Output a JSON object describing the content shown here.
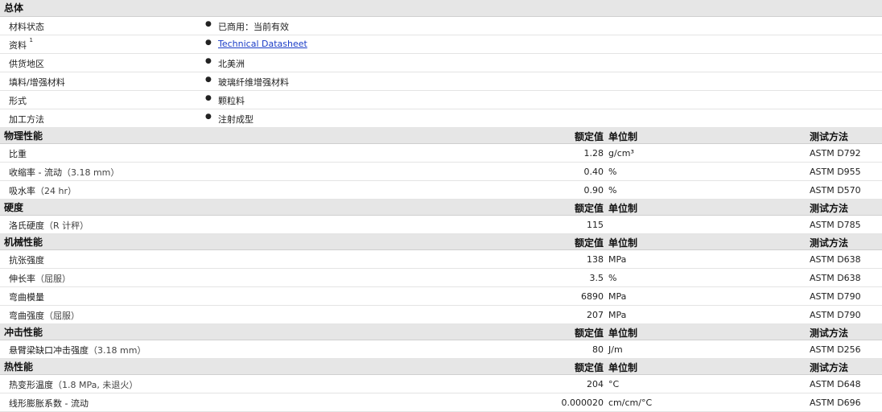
{
  "general": {
    "title": "总体",
    "rows": [
      {
        "label": "材料状态",
        "sup": "",
        "value": "已商用：当前有效",
        "link": false
      },
      {
        "label": "资料",
        "sup": "1",
        "value": "Technical Datasheet",
        "link": true
      },
      {
        "label": "供货地区",
        "sup": "",
        "value": "北美洲",
        "link": false
      },
      {
        "label": "填料/增强材料",
        "sup": "",
        "value": "玻璃纤维增强材料",
        "link": false
      },
      {
        "label": "形式",
        "sup": "",
        "value": "颗粒料",
        "link": false
      },
      {
        "label": "加工方法",
        "sup": "",
        "value": "注射成型",
        "link": false
      }
    ]
  },
  "headers": {
    "value": "额定值",
    "unit": "单位制",
    "method": "测试方法"
  },
  "sections": [
    {
      "title": "物理性能",
      "rows": [
        {
          "label": "比重",
          "cond": "",
          "value": "1.28",
          "unit": "g/cm³",
          "method": "ASTM D792"
        },
        {
          "label": "收缩率 - 流动",
          "cond": "（3.18 mm）",
          "value": "0.40",
          "unit": "%",
          "method": "ASTM D955"
        },
        {
          "label": "吸水率",
          "cond": "（24 hr）",
          "value": "0.90",
          "unit": "%",
          "method": "ASTM D570"
        }
      ]
    },
    {
      "title": "硬度",
      "rows": [
        {
          "label": "洛氏硬度",
          "cond": "（R 计秤）",
          "value": "115",
          "unit": "",
          "method": "ASTM D785"
        }
      ]
    },
    {
      "title": "机械性能",
      "rows": [
        {
          "label": "抗张强度",
          "cond": "",
          "value": "138",
          "unit": "MPa",
          "method": "ASTM D638"
        },
        {
          "label": "伸长率",
          "cond": "（屈服）",
          "value": "3.5",
          "unit": "%",
          "method": "ASTM D638"
        },
        {
          "label": "弯曲模量",
          "cond": "",
          "value": "6890",
          "unit": "MPa",
          "method": "ASTM D790"
        },
        {
          "label": "弯曲强度",
          "cond": "（屈服）",
          "value": "207",
          "unit": "MPa",
          "method": "ASTM D790"
        }
      ]
    },
    {
      "title": "冲击性能",
      "rows": [
        {
          "label": "悬臂梁缺口冲击强度",
          "cond": "（3.18 mm）",
          "value": "80",
          "unit": "J/m",
          "method": "ASTM D256"
        }
      ]
    },
    {
      "title": "热性能",
      "rows": [
        {
          "label": "热变形温度",
          "cond": "（1.8 MPa, 未退火）",
          "value": "204",
          "unit": "°C",
          "method": "ASTM D648"
        },
        {
          "label": "线形膨胀系数 - 流动",
          "cond": "",
          "value": "0.000020",
          "unit": "cm/cm/°C",
          "method": "ASTM D696"
        }
      ]
    }
  ]
}
